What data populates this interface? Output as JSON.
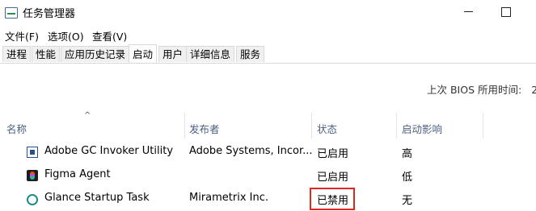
{
  "window": {
    "title": "任务管理器",
    "icon": "task-manager-icon"
  },
  "menu": [
    "文件(F)",
    "选项(O)",
    "查看(V)"
  ],
  "tabs": [
    "进程",
    "性能",
    "应用历史记录",
    "启动",
    "用户",
    "详细信息",
    "服务"
  ],
  "active_tab": "启动",
  "bios": {
    "label": "上次 BIOS 所用时间:",
    "value": "2"
  },
  "columns": [
    "名称",
    "发布者",
    "状态",
    "启动影响"
  ],
  "sort": {
    "column": "名称",
    "glyph": "^"
  },
  "rows": [
    {
      "icon": "adobe-icon",
      "name": "Adobe GC Invoker Utility",
      "publisher": "Adobe Systems, Incor...",
      "status": "已启用",
      "impact": "高"
    },
    {
      "icon": "figma-icon",
      "name": "Figma Agent",
      "publisher": "",
      "status": "已启用",
      "impact": "低"
    },
    {
      "icon": "glance-icon",
      "name": "Glance Startup Task",
      "publisher": "Mirametrix Inc.",
      "status": "已禁用",
      "impact": "无"
    }
  ],
  "highlight_color": "#e0261f"
}
